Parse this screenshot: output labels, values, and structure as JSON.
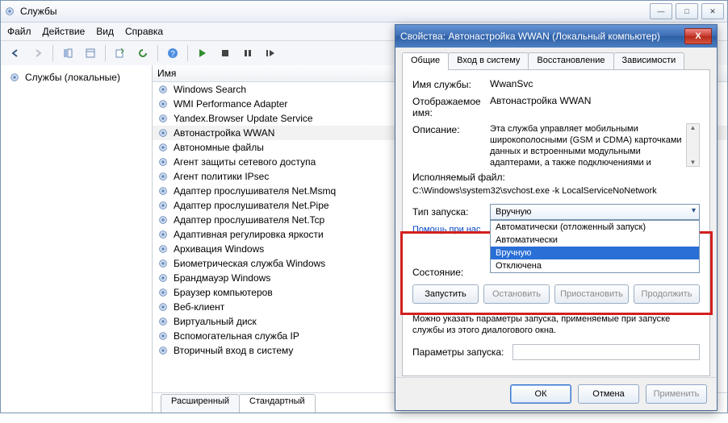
{
  "main": {
    "title": "Службы",
    "menu": [
      "Файл",
      "Действие",
      "Вид",
      "Справка"
    ],
    "left_label": "Службы (локальные)",
    "column_header": "Имя",
    "services": [
      "Windows Search",
      "WMI Performance Adapter",
      "Yandex.Browser Update Service",
      "Автонастройка WWAN",
      "Автономные файлы",
      "Агент защиты сетевого доступа",
      "Агент политики IPsec",
      "Адаптер прослушивателя Net.Msmq",
      "Адаптер прослушивателя Net.Pipe",
      "Адаптер прослушивателя Net.Tcp",
      "Адаптивная регулировка яркости",
      "Архивация Windows",
      "Биометрическая служба Windows",
      "Брандмауэр Windows",
      "Браузер компьютеров",
      "Веб-клиент",
      "Виртуальный диск",
      "Вспомогательная служба IP",
      "Вторичный вход в систему"
    ],
    "selected_index": 3,
    "tabs": {
      "extended": "Расширенный",
      "standard": "Стандартный"
    }
  },
  "dialog": {
    "title": "Свойства: Автонастройка WWAN (Локальный компьютер)",
    "tabs": [
      "Общие",
      "Вход в систему",
      "Восстановление",
      "Зависимости"
    ],
    "labels": {
      "service_name": "Имя службы:",
      "display_name": "Отображаемое имя:",
      "description": "Описание:",
      "exec_label": "Исполняемый файл:",
      "startup_type": "Тип запуска:",
      "help_link": "Помощь при нас",
      "state": "Состояние:",
      "hint": "Можно указать параметры запуска, применяемые при запуске службы из этого диалогового окна.",
      "params": "Параметры запуска:"
    },
    "values": {
      "service_name": "WwanSvc",
      "display_name": "Автонастройка WWAN",
      "description": "Эта служба управляет мобильными широкополосными (GSM и CDMA) карточками данных и встроенными модульными адаптерами, а также подключениями и",
      "exec": "C:\\Windows\\system32\\svchost.exe -k LocalServiceNoNetwork",
      "startup_selected": "Вручную",
      "state": ""
    },
    "startup_options": [
      "Автоматически (отложенный запуск)",
      "Автоматически",
      "Вручную",
      "Отключена"
    ],
    "highlighted_option_index": 2,
    "buttons": {
      "start": "Запустить",
      "stop": "Остановить",
      "pause": "Приостановить",
      "resume": "Продолжить",
      "ok": "ОК",
      "cancel": "Отмена",
      "apply": "Применить"
    }
  }
}
